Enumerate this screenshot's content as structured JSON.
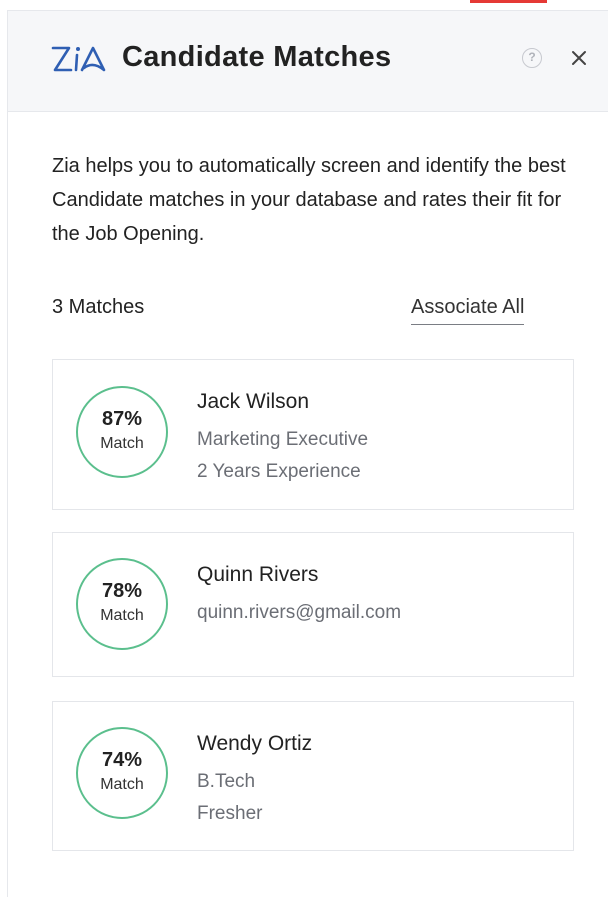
{
  "panel": {
    "title": "Candidate Matches",
    "help_glyph": "?",
    "icons": {
      "logo": "zia-logo-icon",
      "help": "help-icon",
      "close": "close-icon"
    }
  },
  "intro": {
    "description": "Zia helps you to automatically screen and identify the best Candidate matches in your database and rates their fit for the Job Opening."
  },
  "matches": {
    "count_label": "3 Matches",
    "associate_all_label": "Associate All",
    "items": [
      {
        "percent": "87%",
        "match_label": "Match",
        "name": "Jack Wilson",
        "detail_1": "Marketing Executive",
        "detail_2": "2 Years Experience"
      },
      {
        "percent": "78%",
        "match_label": "Match",
        "name": "Quinn Rivers",
        "detail_1": "quinn.rivers@gmail.com"
      },
      {
        "percent": "74%",
        "match_label": "Match",
        "name": "Wendy Ortiz",
        "detail_1": "B.Tech",
        "detail_2": "Fresher"
      }
    ]
  },
  "colors": {
    "accent_red": "#e53935",
    "match_ring": "#5bbf8d",
    "header_bg": "#f6f7f9",
    "logo_blue": "#2f5fb3"
  }
}
